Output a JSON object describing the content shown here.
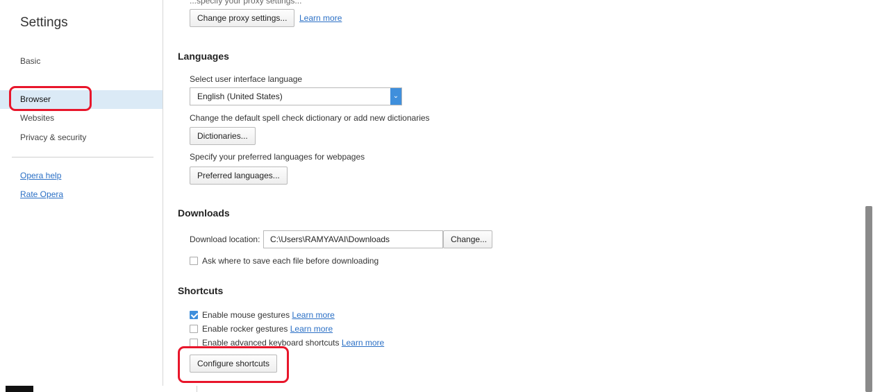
{
  "sidebar": {
    "title": "Settings",
    "items": [
      {
        "label": "Basic"
      },
      {
        "label": "Browser"
      },
      {
        "label": "Websites"
      },
      {
        "label": "Privacy & security"
      }
    ],
    "links": [
      {
        "label": "Opera help"
      },
      {
        "label": "Rate Opera"
      }
    ]
  },
  "main": {
    "cut_text": "...specify your proxy settings...",
    "proxy": {
      "button": "Change proxy settings...",
      "learn_more": "Learn more"
    },
    "languages": {
      "title": "Languages",
      "ui_label": "Select user interface language",
      "ui_value": "English (United States)",
      "spell_label": "Change the default spell check dictionary or add new dictionaries",
      "dict_button": "Dictionaries...",
      "pref_label": "Specify your preferred languages for webpages",
      "pref_button": "Preferred languages..."
    },
    "downloads": {
      "title": "Downloads",
      "location_label": "Download location:",
      "location_value": "C:\\Users\\RAMYAVAI\\Downloads",
      "change_button": "Change...",
      "ask_label": "Ask where to save each file before downloading"
    },
    "shortcuts": {
      "title": "Shortcuts",
      "mouse": "Enable mouse gestures",
      "rocker": "Enable rocker gestures",
      "keyboard": "Enable advanced keyboard shortcuts",
      "learn_more": "Learn more",
      "configure_button": "Configure shortcuts"
    }
  },
  "colors": {
    "accent": "#3f8fdc",
    "link": "#2a6fc5",
    "highlight": "#e8162b",
    "selected_bg": "#dbeaf6"
  }
}
